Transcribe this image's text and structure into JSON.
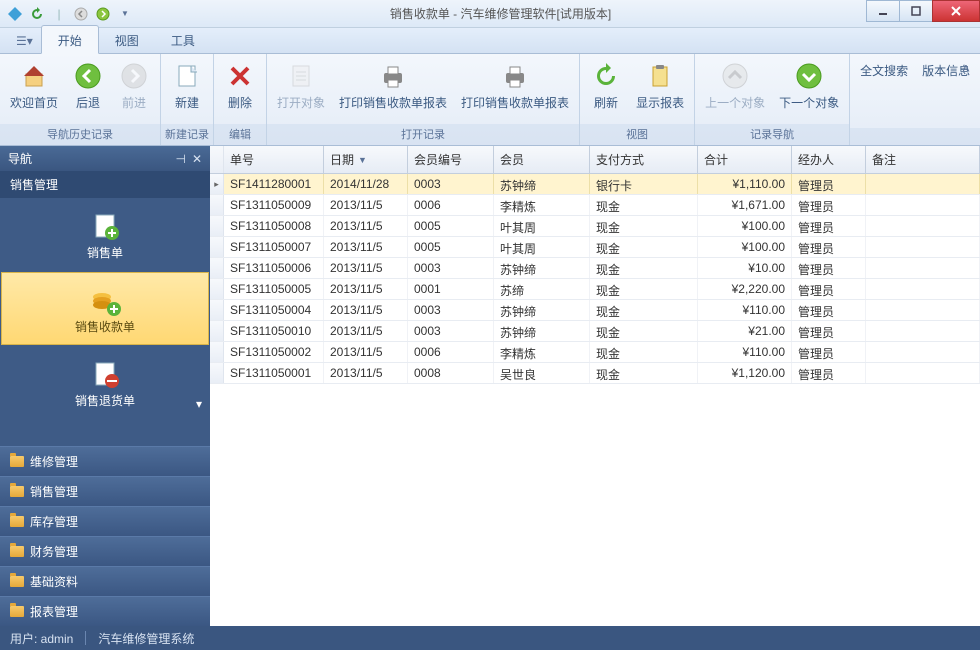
{
  "title": "销售收款单 - 汽车维修管理软件[试用版本]",
  "tabs": {
    "start": "开始",
    "view": "视图",
    "tools": "工具"
  },
  "ribbon": {
    "welcome": "欢迎首页",
    "back": "后退",
    "forward": "前进",
    "new": "新建",
    "delete": "删除",
    "open_obj": "打开对象",
    "print_report": "打印销售收款单报表",
    "print_table": "打印销售收款单报表",
    "refresh": "刷新",
    "show_report": "显示报表",
    "prev_obj": "上一个对象",
    "next_obj": "下一个对象",
    "search": "全文搜索",
    "version": "版本信息",
    "g_nav": "导航历史记录",
    "g_newrec": "新建记录",
    "g_edit": "编辑",
    "g_openrec": "打开记录",
    "g_view": "视图",
    "g_recnav": "记录导航"
  },
  "sidebar": {
    "head": "导航",
    "sub": "销售管理",
    "items": [
      {
        "label": "销售单"
      },
      {
        "label": "销售收款单"
      },
      {
        "label": "销售退货单"
      }
    ],
    "accordion": [
      "维修管理",
      "销售管理",
      "库存管理",
      "财务管理",
      "基础资料",
      "报表管理"
    ]
  },
  "grid": {
    "headers": {
      "no": "单号",
      "date": "日期",
      "member": "会员编号",
      "name": "会员",
      "pay": "支付方式",
      "total": "合计",
      "op": "经办人",
      "note": "备注"
    },
    "rows": [
      {
        "no": "SF1411280001",
        "date": "2014/11/28",
        "member": "0003",
        "name": "苏钟缔",
        "pay": "银行卡",
        "total": "¥1,110.00",
        "op": "管理员",
        "note": ""
      },
      {
        "no": "SF1311050009",
        "date": "2013/11/5",
        "member": "0006",
        "name": "李精炼",
        "pay": "现金",
        "total": "¥1,671.00",
        "op": "管理员",
        "note": ""
      },
      {
        "no": "SF1311050008",
        "date": "2013/11/5",
        "member": "0005",
        "name": "叶其周",
        "pay": "现金",
        "total": "¥100.00",
        "op": "管理员",
        "note": ""
      },
      {
        "no": "SF1311050007",
        "date": "2013/11/5",
        "member": "0005",
        "name": "叶其周",
        "pay": "现金",
        "total": "¥100.00",
        "op": "管理员",
        "note": ""
      },
      {
        "no": "SF1311050006",
        "date": "2013/11/5",
        "member": "0003",
        "name": "苏钟缔",
        "pay": "现金",
        "total": "¥10.00",
        "op": "管理员",
        "note": ""
      },
      {
        "no": "SF1311050005",
        "date": "2013/11/5",
        "member": "0001",
        "name": "苏缔",
        "pay": "现金",
        "total": "¥2,220.00",
        "op": "管理员",
        "note": ""
      },
      {
        "no": "SF1311050004",
        "date": "2013/11/5",
        "member": "0003",
        "name": "苏钟缔",
        "pay": "现金",
        "total": "¥110.00",
        "op": "管理员",
        "note": ""
      },
      {
        "no": "SF1311050010",
        "date": "2013/11/5",
        "member": "0003",
        "name": "苏钟缔",
        "pay": "现金",
        "total": "¥21.00",
        "op": "管理员",
        "note": ""
      },
      {
        "no": "SF1311050002",
        "date": "2013/11/5",
        "member": "0006",
        "name": "李精炼",
        "pay": "现金",
        "total": "¥110.00",
        "op": "管理员",
        "note": ""
      },
      {
        "no": "SF1311050001",
        "date": "2013/11/5",
        "member": "0008",
        "name": "吴世良",
        "pay": "现金",
        "total": "¥1,120.00",
        "op": "管理员",
        "note": ""
      }
    ]
  },
  "status": {
    "user_label": "用户: ",
    "user": "admin",
    "system": "汽车维修管理系统"
  }
}
